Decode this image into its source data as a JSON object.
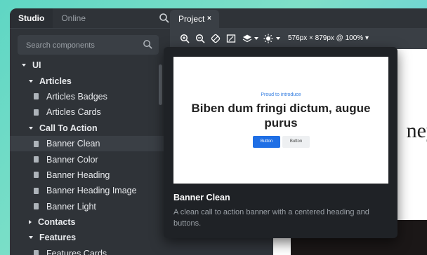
{
  "sidebar": {
    "tabs": [
      {
        "label": "Studio",
        "active": true
      },
      {
        "label": "Online",
        "active": false
      }
    ],
    "search": {
      "placeholder": "Search components",
      "value": ""
    },
    "tree": [
      {
        "label": "UI",
        "type": "folder",
        "expanded": true,
        "level": 0
      },
      {
        "label": "Articles",
        "type": "folder",
        "expanded": true,
        "level": 1
      },
      {
        "label": "Articles Badges",
        "type": "component",
        "level": 2
      },
      {
        "label": "Articles Cards",
        "type": "component",
        "level": 2
      },
      {
        "label": "Call To Action",
        "type": "folder",
        "expanded": true,
        "level": 1
      },
      {
        "label": "Banner Clean",
        "type": "component",
        "level": 2,
        "selected": true
      },
      {
        "label": "Banner Color",
        "type": "component",
        "level": 2
      },
      {
        "label": "Banner Heading",
        "type": "component",
        "level": 2
      },
      {
        "label": "Banner Heading Image",
        "type": "component",
        "level": 2
      },
      {
        "label": "Banner Light",
        "type": "component",
        "level": 2
      },
      {
        "label": "Contacts",
        "type": "folder",
        "expanded": false,
        "level": 1
      },
      {
        "label": "Features",
        "type": "folder",
        "expanded": true,
        "level": 1
      },
      {
        "label": "Features Cards",
        "type": "component",
        "level": 2
      }
    ]
  },
  "main": {
    "tab": {
      "label": "Project",
      "close": "×"
    },
    "toolbar": {
      "icons": [
        "zoom-in-icon",
        "zoom-out-icon",
        "rotate-icon",
        "fit-screen-icon",
        "layers-icon",
        "brightness-icon"
      ],
      "viewport_label": "576px × 879px @ 100% ▾"
    },
    "canvas_peek_text": "ney"
  },
  "popover": {
    "preview": {
      "eyebrow": "Proud to introduce",
      "heading": "Biben dum fringi dictum, augue purus",
      "primary_button": "Button",
      "secondary_button": "Button"
    },
    "title": "Banner Clean",
    "description": "A clean call to action banner with a centered heading and buttons."
  },
  "colors": {
    "accent": "#1f6fe5",
    "eyebrow": "#2f7be0",
    "sidebar_bg": "#2f3338",
    "popover_bg": "#1f2226"
  }
}
